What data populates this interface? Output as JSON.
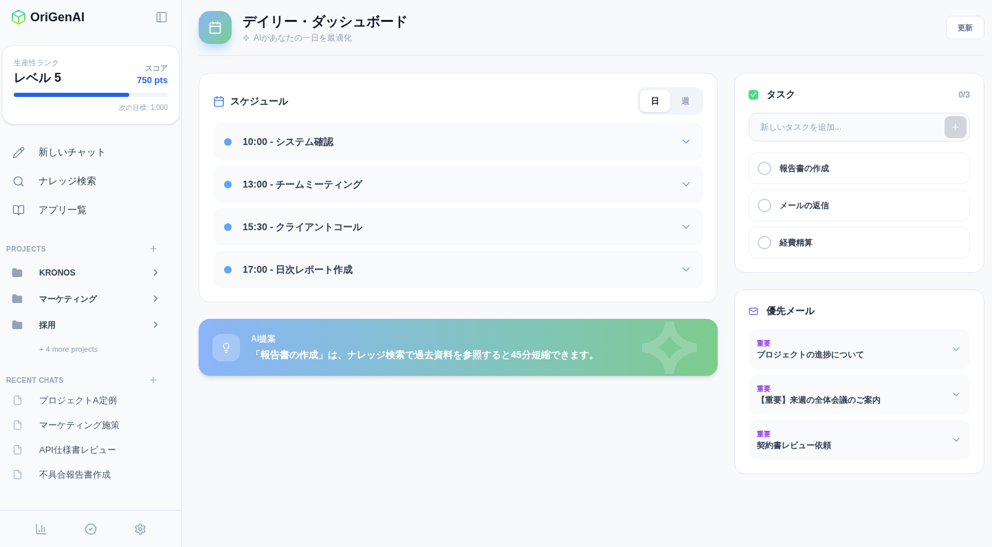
{
  "sidebar": {
    "logo": "OriGenAI",
    "rank": {
      "label": "生産性ランク",
      "level_text": "レベル 5",
      "score_label": "スコア",
      "score": "750 pts",
      "level": 0.75,
      "goal": "次の目標: 1,000"
    },
    "nav": [
      {
        "kind": "pencil",
        "label": "新しいチャット"
      },
      {
        "kind": "search",
        "label": "ナレッジ検索"
      },
      {
        "kind": "book",
        "label": "アプリ一覧"
      }
    ],
    "projects": {
      "title": "PROJECTS",
      "items": [
        "KRONOS",
        "マーケティング",
        "採用"
      ],
      "more": "+ 4 more projects"
    },
    "recent": {
      "title": "RECENT CHATS",
      "items": [
        "プロジェクトA定例",
        "マーケティング施策",
        "API仕様書レビュー",
        "不具合報告書作成"
      ]
    }
  },
  "header": {
    "title": "デイリー・ダッシュボード",
    "subtitle": "AIがあなたの一日を最適化",
    "button": "更新"
  },
  "schedule": {
    "title": "スケジュール",
    "tabs": [
      {
        "label": "日",
        "selected": true
      },
      {
        "label": "週",
        "selected": false
      }
    ],
    "items": [
      {
        "text": "10:00 - システム確認",
        "color": "#60a5fa"
      },
      {
        "text": "13:00 - チームミーティング",
        "color": "#60a5fa"
      },
      {
        "text": "15:30 - クライアントコール",
        "color": "#60a5fa"
      },
      {
        "text": "17:00 - 日次レポート作成",
        "color": "#60a5fa"
      }
    ]
  },
  "suggestion": {
    "title": "AI提案",
    "text": "「報告書の作成」は、ナレッジ検索で過去資料を参照すると45分短縮できます。"
  },
  "tasks": {
    "title": "タスク",
    "count": "0/3",
    "placeholder": "新しいタスクを追加...",
    "items": [
      {
        "label": "報告書の作成",
        "checked": false
      },
      {
        "label": "メールの返信",
        "checked": false
      },
      {
        "label": "経費精算",
        "checked": false
      }
    ]
  },
  "mail": {
    "title": "優先メール",
    "items": [
      {
        "tag": "重要",
        "subject": "プロジェクトの進捗について"
      },
      {
        "tag": "重要",
        "subject": "【重要】来週の全体会議のご案内"
      },
      {
        "tag": "重要",
        "subject": "契約書レビュー依頼"
      }
    ]
  }
}
